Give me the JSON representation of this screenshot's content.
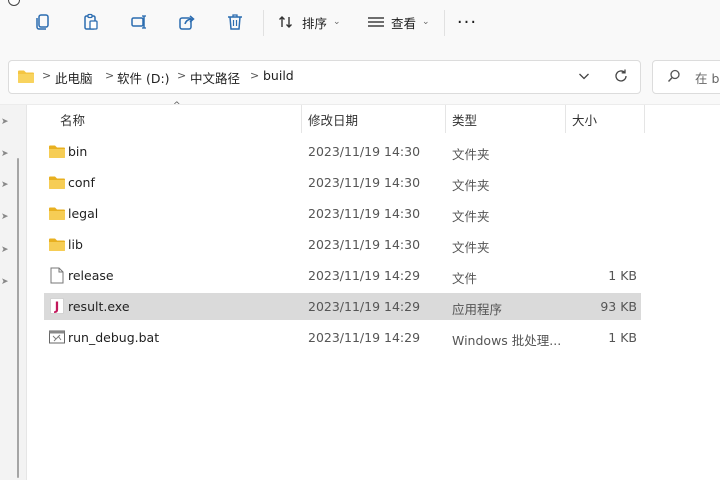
{
  "toolbar": {
    "icons": [
      "copy-icon",
      "paste-icon",
      "rename-icon",
      "share-icon",
      "delete-icon"
    ],
    "sort_label": "排序",
    "view_label": "查看",
    "more_label": "···"
  },
  "address": {
    "crumbs": [
      "此电脑",
      "软件 (D:)",
      "中文路径",
      "build"
    ],
    "search_placeholder": "在 bu"
  },
  "columns": {
    "name": "名称",
    "date": "修改日期",
    "type": "类型",
    "size": "大小"
  },
  "files": [
    {
      "name": "bin",
      "date": "2023/11/19 14:30",
      "type": "文件夹",
      "size": "",
      "icon": "folder-icon",
      "selected": false
    },
    {
      "name": "conf",
      "date": "2023/11/19 14:30",
      "type": "文件夹",
      "size": "",
      "icon": "folder-icon",
      "selected": false
    },
    {
      "name": "legal",
      "date": "2023/11/19 14:30",
      "type": "文件夹",
      "size": "",
      "icon": "folder-icon",
      "selected": false
    },
    {
      "name": "lib",
      "date": "2023/11/19 14:30",
      "type": "文件夹",
      "size": "",
      "icon": "folder-icon",
      "selected": false
    },
    {
      "name": "release",
      "date": "2023/11/19 14:29",
      "type": "文件",
      "size": "1 KB",
      "icon": "file-icon",
      "selected": false
    },
    {
      "name": "result.exe",
      "date": "2023/11/19 14:29",
      "type": "应用程序",
      "size": "93 KB",
      "icon": "java-app-icon",
      "selected": true
    },
    {
      "name": "run_debug.bat",
      "date": "2023/11/19 14:29",
      "type": "Windows 批处理...",
      "size": "1 KB",
      "icon": "batch-file-icon",
      "selected": false
    }
  ],
  "colors": {
    "folder": "#f4c542",
    "folder_dark": "#e0a800",
    "selected_row": "#dadada",
    "java_icon": "#c2185b"
  }
}
